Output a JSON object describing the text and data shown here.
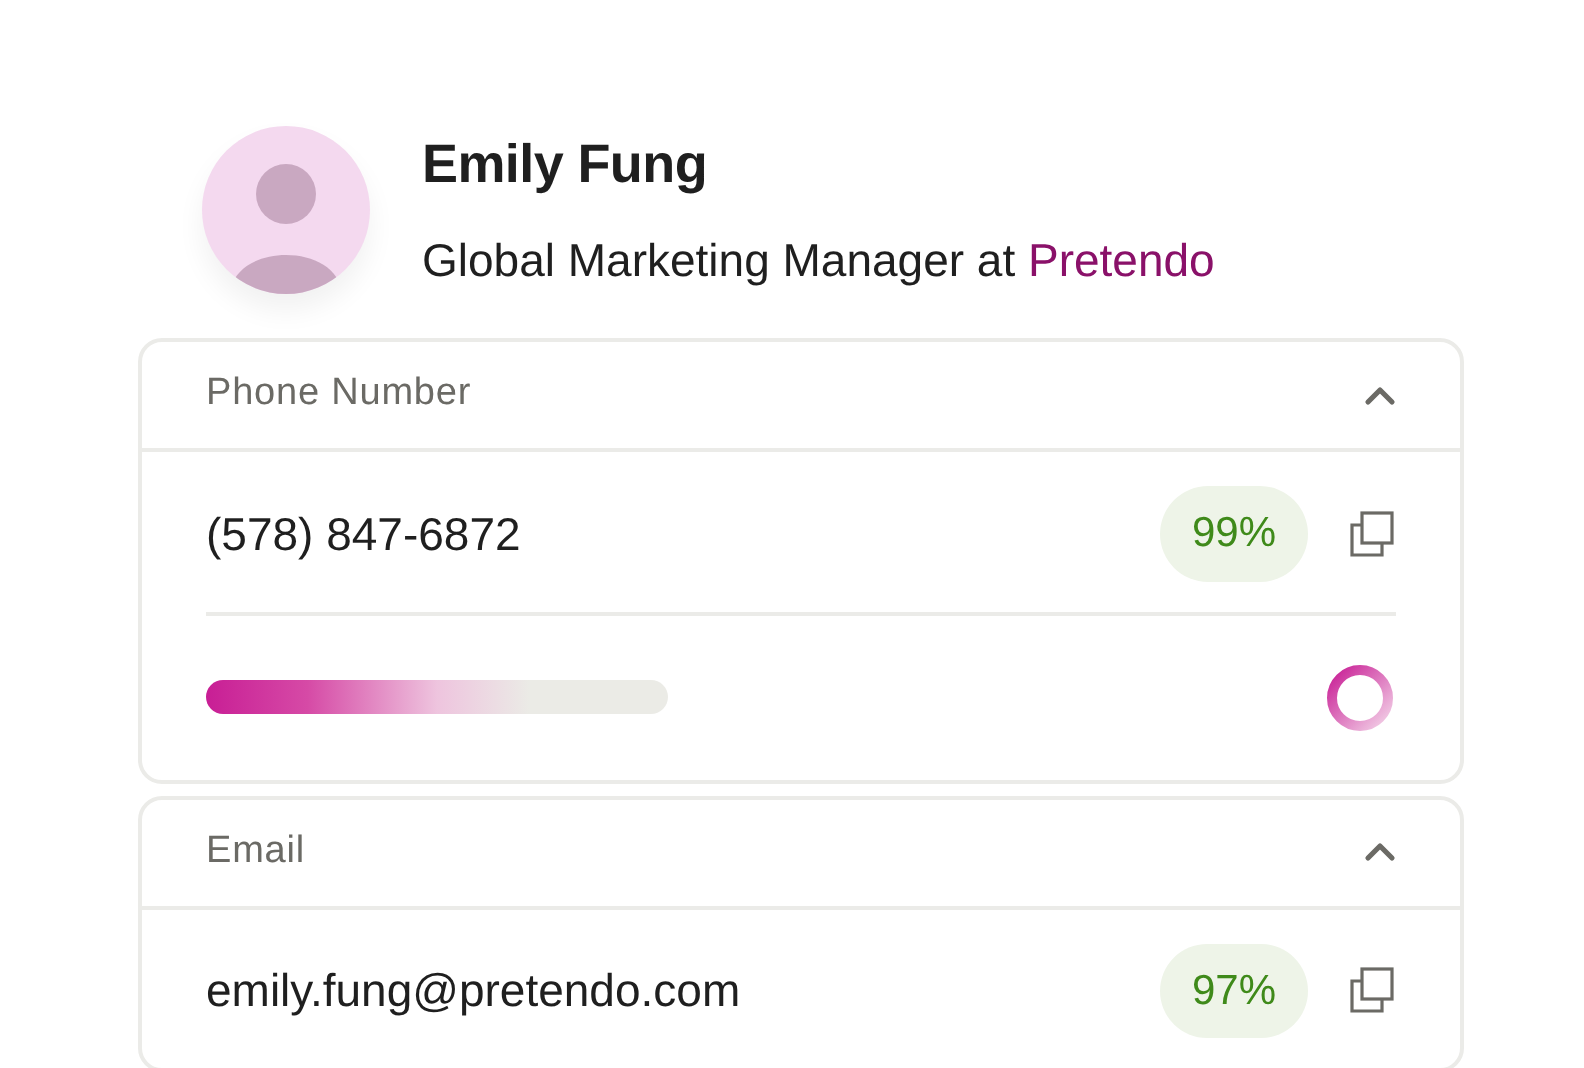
{
  "profile": {
    "name": "Emily Fung",
    "role": "Global Marketing Manager at",
    "company": "Pretendo"
  },
  "sections": [
    {
      "label": "Phone Number",
      "expanded": true,
      "value": "(578) 847-6872",
      "confidence": "99%",
      "loading": true
    },
    {
      "label": "Email",
      "expanded": true,
      "value": "emily.fung@pretendo.com",
      "confidence": "97%",
      "loading": false
    }
  ]
}
